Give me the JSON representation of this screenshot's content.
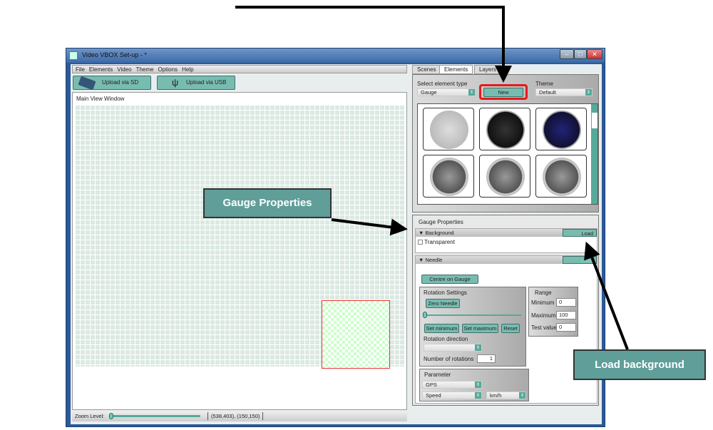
{
  "window": {
    "title": "Video VBOX Set-up - *",
    "controls": [
      "–",
      "□",
      "✕"
    ]
  },
  "menu": [
    "File",
    "Elements",
    "Video",
    "Theme",
    "Options",
    "Help"
  ],
  "toolbar": {
    "sd": "Upload via SD card",
    "usb": "Upload via USB"
  },
  "main": {
    "title": "Main View Window"
  },
  "status": {
    "zoom_label": "Zoom Level:",
    "zoom_value": 0,
    "coords": "(538,403), (150,150)"
  },
  "tabs": [
    {
      "label": "Scenes"
    },
    {
      "label": "Elements",
      "active": true
    },
    {
      "label": "Layers"
    }
  ],
  "elements": {
    "type_label": "Select element type",
    "type_value": "Gauge",
    "new_label": "New",
    "theme_label": "Theme",
    "theme_value": "Default"
  },
  "props": {
    "title": "Gauge Properties",
    "background": "Background",
    "load": "Load",
    "transparent": "Transparent",
    "needle": "Needle",
    "needle_load": "Load",
    "centre": "Centre on Gauge",
    "rotation": {
      "title": "Rotation Settings",
      "zero": "Zero Needle",
      "set_min": "Set minimum",
      "set_max": "Set maximum",
      "reset": "Reset",
      "direction": "Rotation direction",
      "direction_value": "",
      "num_label": "Number of rotations",
      "num_value": "1"
    },
    "range": {
      "title": "Range",
      "min_label": "Minimum",
      "min": "0",
      "max_label": "Maximum",
      "max": "100",
      "test_label": "Test value",
      "test": "0"
    },
    "parameter": {
      "title": "Parameter",
      "source": "GPS",
      "channel": "Speed",
      "unit": "km/h"
    }
  },
  "annotations": {
    "gauge": "Gauge Properties",
    "load": "Load background"
  },
  "colors": {
    "accent": "#78bcb0",
    "callout": "#5f9e99",
    "highlight": "#e31b1b"
  }
}
